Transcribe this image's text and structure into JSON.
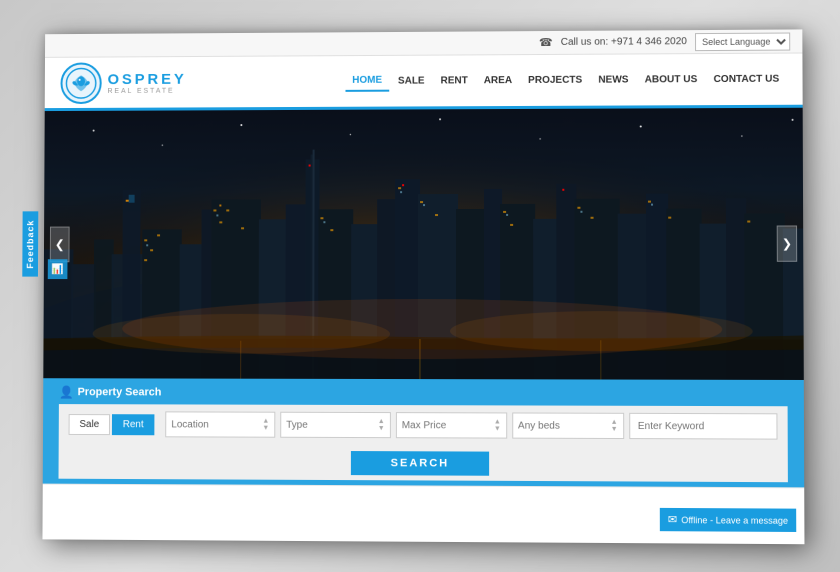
{
  "topbar": {
    "phone_label": "Call us on: +971 4 346 2020",
    "lang_placeholder": "Select Language"
  },
  "navbar": {
    "logo_name": "OSPREY",
    "logo_sub": "REAL ESTATE",
    "links": [
      {
        "label": "HOME",
        "active": true
      },
      {
        "label": "SALE",
        "active": false
      },
      {
        "label": "RENT",
        "active": false
      },
      {
        "label": "AREA",
        "active": false
      },
      {
        "label": "PROJECTS",
        "active": false
      },
      {
        "label": "NEWS",
        "active": false
      },
      {
        "label": "ABOUT US",
        "active": false
      },
      {
        "label": "CONTACT US",
        "active": false
      }
    ]
  },
  "feedback": {
    "label": "Feedback"
  },
  "hero": {
    "prev_arrow": "❮",
    "next_arrow": "❯"
  },
  "search": {
    "title": "Property Search",
    "tabs": [
      "Sale",
      "Rent"
    ],
    "active_tab": "Sale",
    "fields": [
      {
        "placeholder": "Location"
      },
      {
        "placeholder": "Type"
      },
      {
        "placeholder": "Max Price"
      },
      {
        "placeholder": "Any beds"
      }
    ],
    "keyword_placeholder": "Enter Keyword",
    "search_button": "SEARCH"
  },
  "offline": {
    "label": "Offline - Leave a message",
    "icon": "✉"
  }
}
